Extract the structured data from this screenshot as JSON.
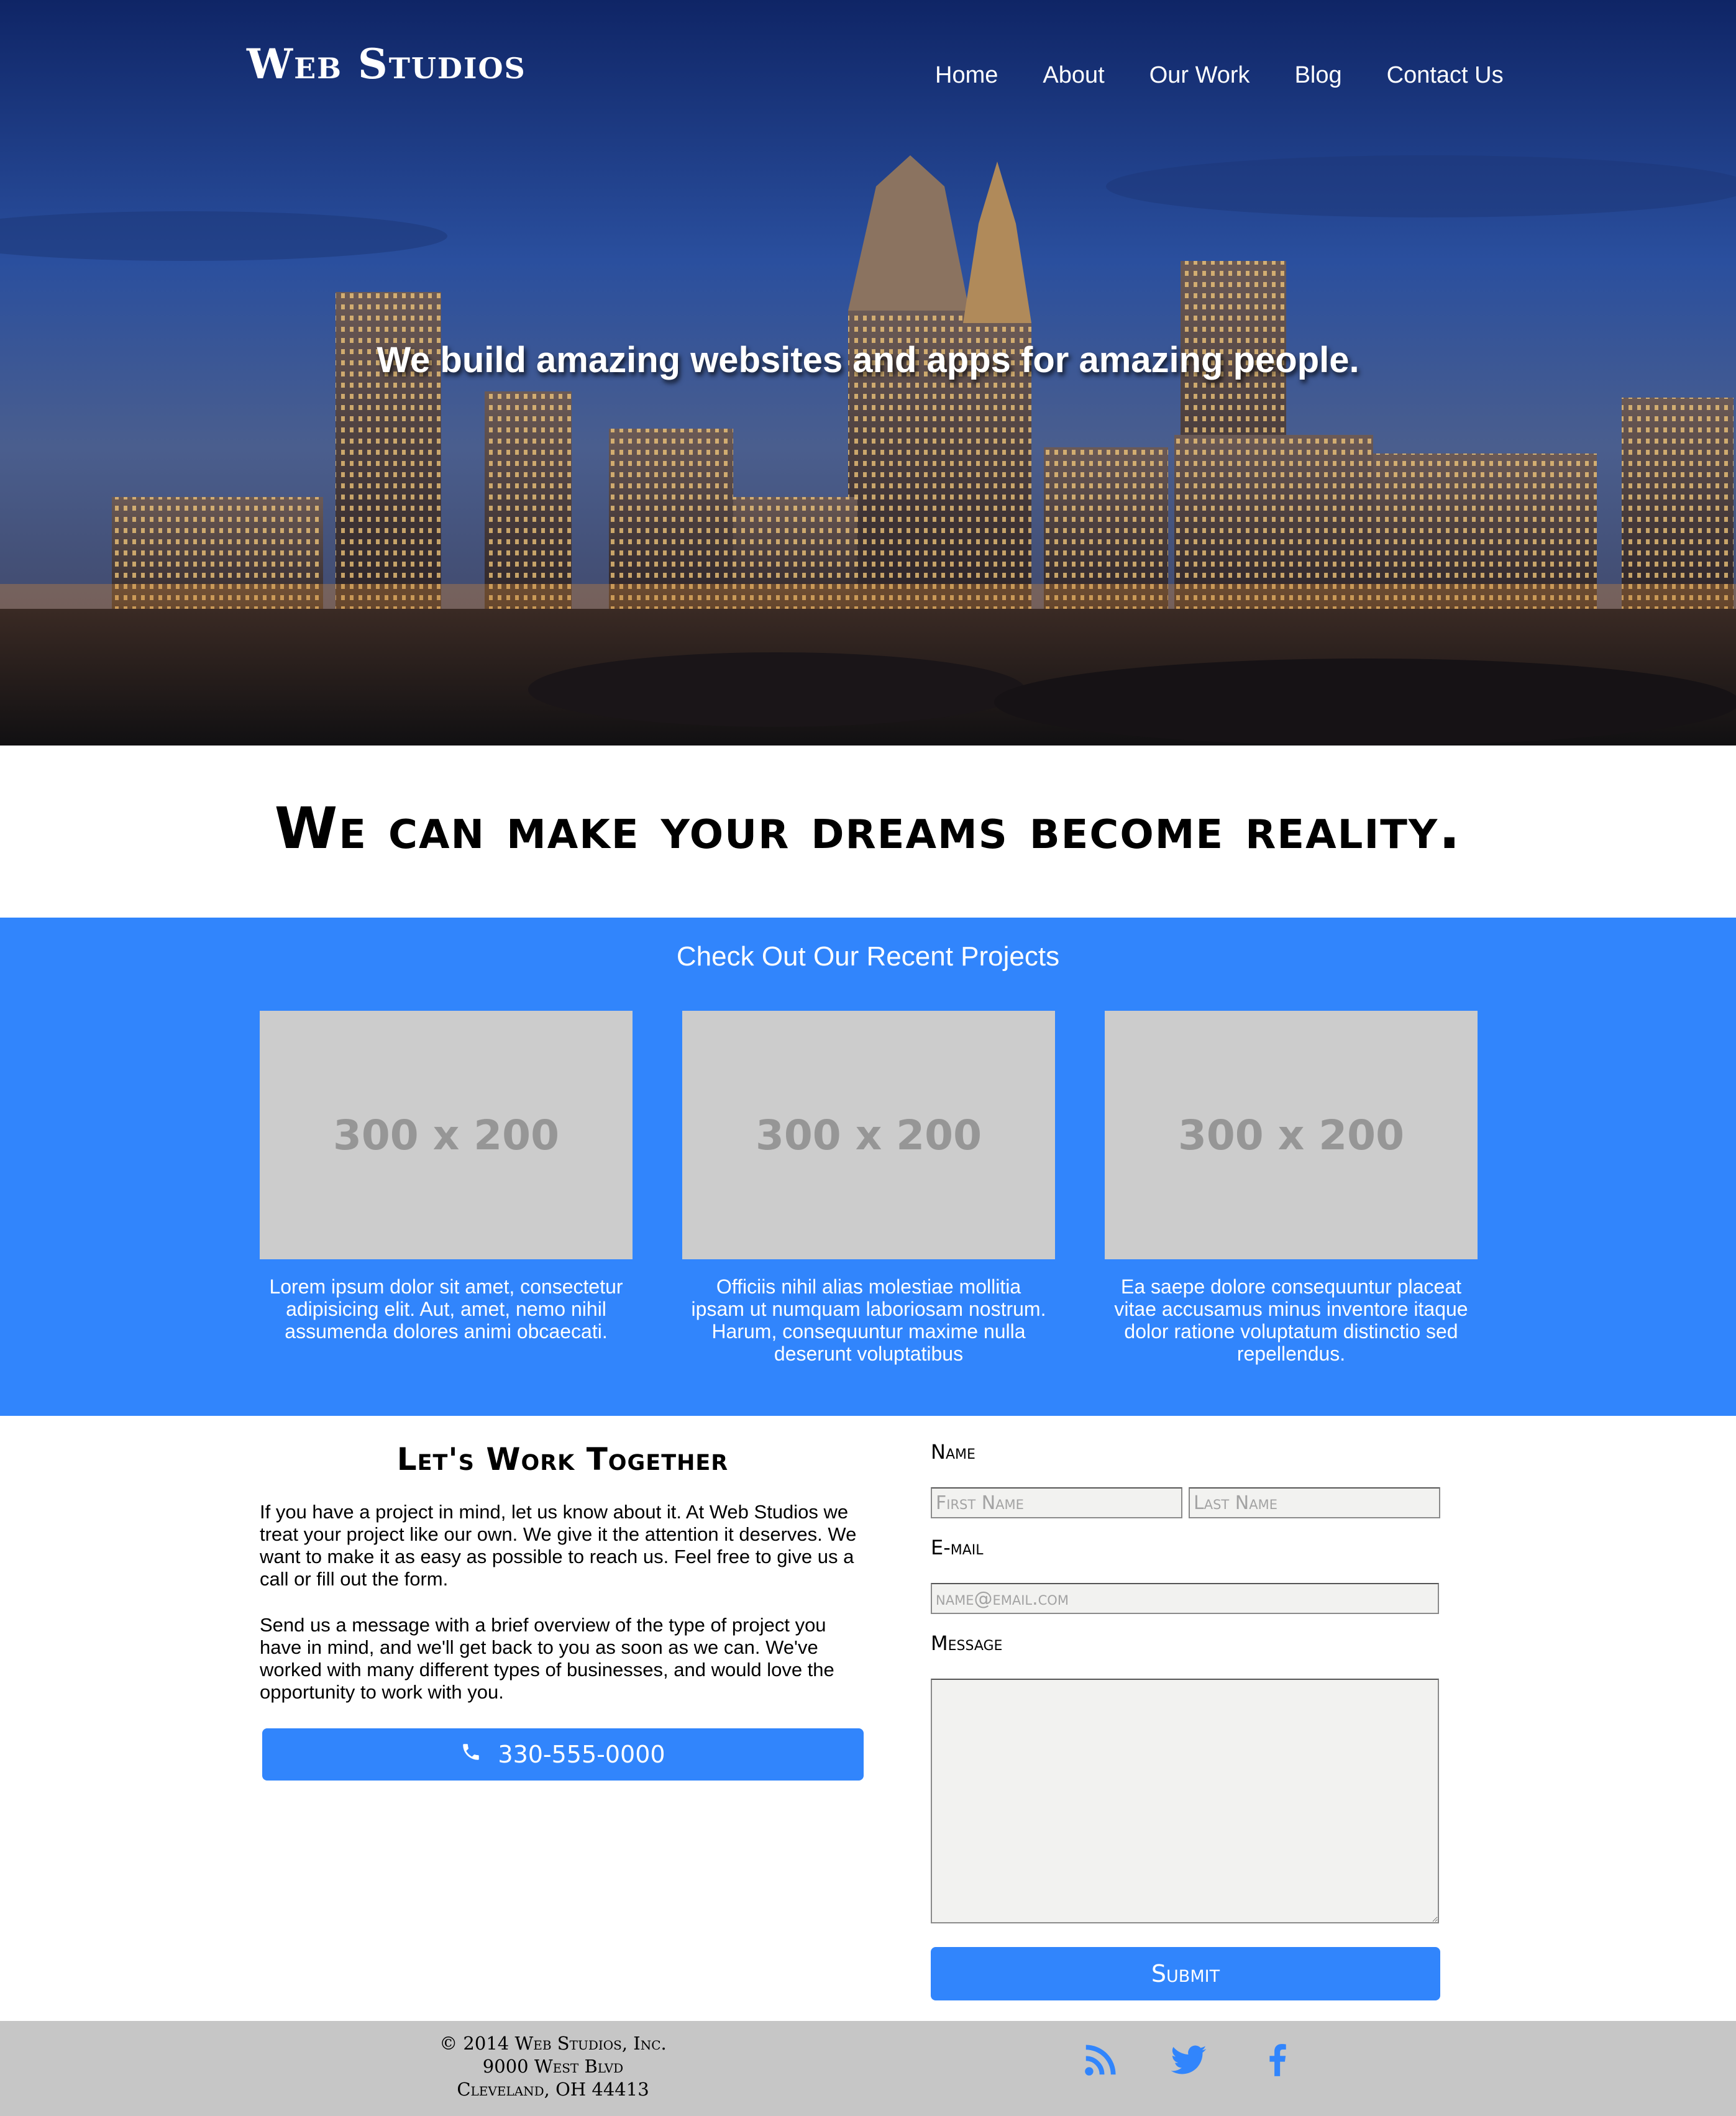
{
  "brand": {
    "logo_text": "Web Studios",
    "accent_color": "#3185fc"
  },
  "nav": {
    "items": [
      {
        "label": "Home"
      },
      {
        "label": "About"
      },
      {
        "label": "Our Work"
      },
      {
        "label": "Blog"
      },
      {
        "label": "Contact Us"
      }
    ]
  },
  "hero": {
    "tagline": "We build amazing websites and apps for amazing people."
  },
  "headline": {
    "text": "We can make your dreams become reality."
  },
  "projects": {
    "title": "Check Out Our Recent Projects",
    "items": [
      {
        "placeholder": "300 x 200",
        "description": "Lorem ipsum dolor sit amet, consectetur adipisicing elit. Aut, amet, nemo nihil assumenda dolores animi obcaecati."
      },
      {
        "placeholder": "300 x 200",
        "description": "Officiis nihil alias molestiae mollitia ipsam ut numquam laboriosam nostrum. Harum, consequuntur maxime nulla deserunt voluptatibus"
      },
      {
        "placeholder": "300 x 200",
        "description": "Ea saepe dolore consequuntur placeat vitae accusamus minus inventore itaque dolor ratione voluptatum distinctio sed repellendus."
      }
    ]
  },
  "contact": {
    "title": "Let's Work Together",
    "paragraph1": "If you have a project in mind, let us know about it. At Web Studios we treat your project like our own. We give it the attention it deserves. We want to make it as easy as possible to reach us. Feel free to give us a call or fill out the form.",
    "paragraph2": "Send us a message with a brief overview of the type of project you have in mind, and we'll get back to you as soon as we can. We've worked with many different types of businesses, and would love the opportunity to work with you.",
    "phone": "330-555-0000",
    "phone_icon": "phone-icon"
  },
  "form": {
    "name_label": "Name",
    "first_name_placeholder": "First Name",
    "last_name_placeholder": "Last Name",
    "email_label": "E-mail",
    "email_placeholder": "name@email.com",
    "message_label": "Message",
    "submit_label": "Submit"
  },
  "footer": {
    "copyright": "© 2014 Web Studios, Inc.",
    "address_line1": "9000 West Blvd",
    "address_line2": "Cleveland, OH 44413",
    "social": [
      "rss-icon",
      "twitter-icon",
      "facebook-icon"
    ]
  }
}
